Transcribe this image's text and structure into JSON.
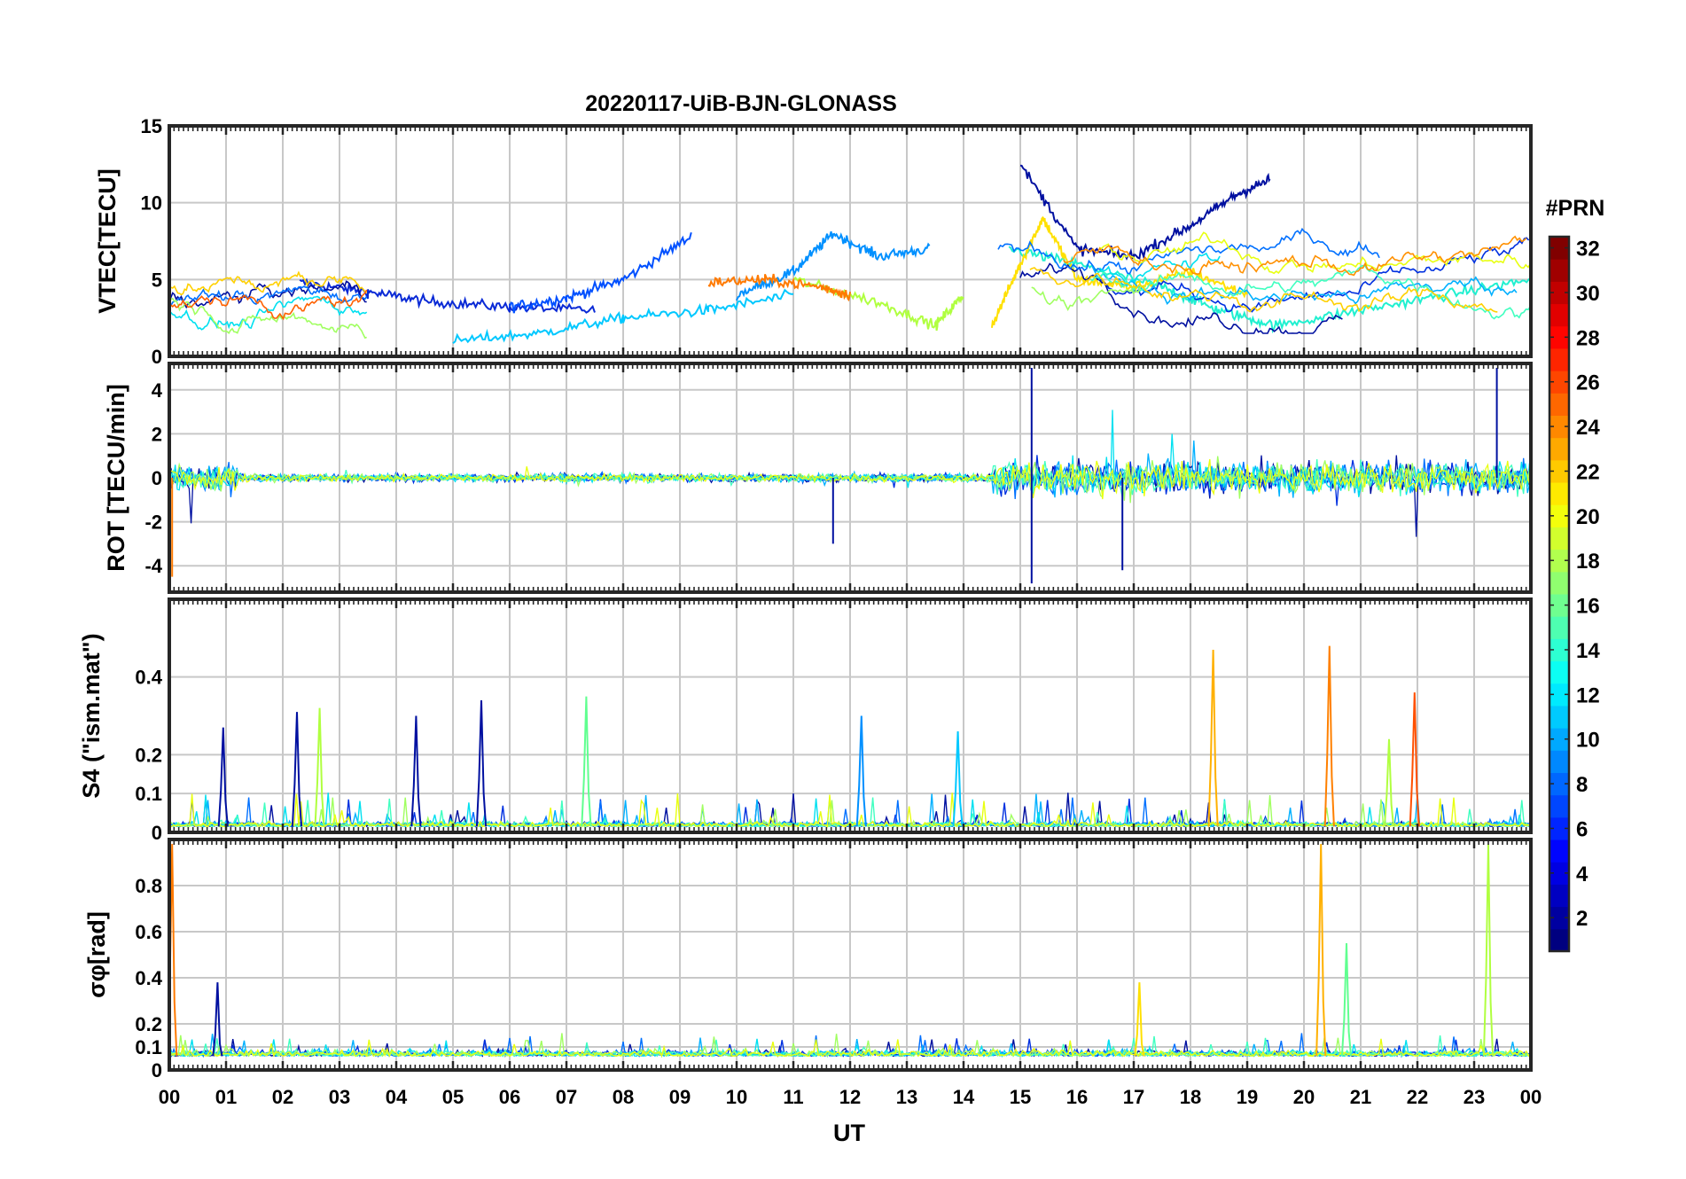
{
  "chart_data": {
    "title": "20220117-UiB-BJN-GLONASS",
    "xlabel": "UT",
    "x_tick_labels": [
      "00",
      "01",
      "02",
      "03",
      "04",
      "05",
      "06",
      "07",
      "08",
      "09",
      "10",
      "11",
      "12",
      "13",
      "14",
      "15",
      "16",
      "17",
      "18",
      "19",
      "20",
      "21",
      "22",
      "23",
      "00"
    ],
    "xlim": [
      0,
      24
    ],
    "grid": true,
    "colorbar": {
      "label": "#PRN",
      "range": [
        1,
        32
      ],
      "tick_labels": [
        "2",
        "4",
        "6",
        "8",
        "10",
        "12",
        "14",
        "16",
        "18",
        "20",
        "22",
        "24",
        "26",
        "28",
        "30",
        "32"
      ],
      "colormap": "jet"
    },
    "panels": [
      {
        "type": "line",
        "ylabel": "VTEC[TECU]",
        "ylim": [
          0,
          15
        ],
        "y_tick_labels": [
          "0",
          "5",
          "10",
          "15"
        ],
        "series": [
          {
            "prn": 3,
            "color": "#0a2ad6",
            "x": [
              2.3,
              3.5,
              4.5,
              6.0,
              7.5
            ],
            "y": [
              4.8,
              4.2,
              3.6,
              3.2,
              3.0
            ]
          },
          {
            "prn": 5,
            "color": "#0050ff",
            "x": [
              6.0,
              7.0,
              8.0,
              9.2
            ],
            "y": [
              3.2,
              3.8,
              5.0,
              7.8
            ]
          },
          {
            "prn": 7,
            "color": "#0090ff",
            "x": [
              10.0,
              11.0,
              11.7,
              12.5,
              13.4
            ],
            "y": [
              4.0,
              5.5,
              8.0,
              6.5,
              7.0
            ]
          },
          {
            "prn": 10,
            "color": "#00c8ff",
            "x": [
              5.0,
              6.5,
              8.0,
              9.5,
              11.0
            ],
            "y": [
              1.0,
              1.5,
              2.5,
              3.0,
              4.0
            ]
          },
          {
            "prn": 13,
            "color": "#20f0d0",
            "x": [
              14.8,
              16.0,
              17.5,
              18.5,
              19.5,
              21.0,
              22.5,
              24.0
            ],
            "y": [
              7.0,
              6.0,
              4.5,
              3.0,
              2.0,
              3.0,
              4.0,
              5.0
            ]
          },
          {
            "prn": 17,
            "color": "#b0ff40",
            "x": [
              11.0,
              12.5,
              13.5,
              14.0
            ],
            "y": [
              5.0,
              3.5,
              2.0,
              4.0
            ]
          },
          {
            "prn": 20,
            "color": "#ffe000",
            "x": [
              14.5,
              15.0,
              15.4,
              16.0,
              17.0,
              18.0,
              19.0
            ],
            "y": [
              2.0,
              6.0,
              9.0,
              5.0,
              4.5,
              5.5,
              4.0
            ]
          },
          {
            "prn": 23,
            "color": "#ff7a00",
            "x": [
              9.5,
              10.5,
              11.5,
              12.0
            ],
            "y": [
              4.8,
              5.0,
              4.5,
              4.0
            ]
          },
          {
            "prn": 2,
            "color": "#0010a0",
            "x": [
              15.0,
              16.0,
              17.0,
              18.0,
              18.8,
              19.4
            ],
            "y": [
              12.5,
              7.0,
              6.5,
              8.5,
              10.5,
              11.5
            ]
          }
        ]
      },
      {
        "type": "line",
        "ylabel": "ROT [TECU/min]",
        "ylim": [
          -5.2,
          5.2
        ],
        "y_tick_labels": [
          "-4",
          "-2",
          "0",
          "2",
          "4"
        ],
        "description_of_data": "Rate of TEC noise centered at 0; amplitude about ±0.3 before 14.5 UT, about ±2 after 14.5 UT with spikes to ±5 near 15.2 UT."
      },
      {
        "type": "line",
        "ylabel": "S4 (\"ism.mat\")",
        "ylim": [
          0,
          0.6
        ],
        "y_tick_labels": [
          "0",
          "0.1",
          "0.2",
          "0.4"
        ],
        "peaks": [
          {
            "x": 0.95,
            "y": 0.27,
            "color": "#0010a0"
          },
          {
            "x": 2.25,
            "y": 0.31,
            "color": "#0010a0"
          },
          {
            "x": 2.65,
            "y": 0.32,
            "color": "#b0ff40"
          },
          {
            "x": 4.35,
            "y": 0.3,
            "color": "#0010a0"
          },
          {
            "x": 5.5,
            "y": 0.34,
            "color": "#0010a0"
          },
          {
            "x": 7.35,
            "y": 0.35,
            "color": "#60ff90"
          },
          {
            "x": 12.2,
            "y": 0.3,
            "color": "#0090ff"
          },
          {
            "x": 13.9,
            "y": 0.26,
            "color": "#00c8ff"
          },
          {
            "x": 18.4,
            "y": 0.47,
            "color": "#ffb000"
          },
          {
            "x": 20.45,
            "y": 0.48,
            "color": "#ff8000"
          },
          {
            "x": 21.95,
            "y": 0.36,
            "color": "#ff5000"
          },
          {
            "x": 21.5,
            "y": 0.24,
            "color": "#b0ff40"
          }
        ]
      },
      {
        "type": "line",
        "ylabel": "σφ[rad]",
        "ylim": [
          0,
          1.0
        ],
        "y_tick_labels": [
          "0",
          "0.1",
          "0.2",
          "0.4",
          "0.6",
          "0.8"
        ],
        "peaks": [
          {
            "x": 0.05,
            "y": 0.98,
            "color": "#ff7a00"
          },
          {
            "x": 0.85,
            "y": 0.38,
            "color": "#0010a0"
          },
          {
            "x": 17.1,
            "y": 0.38,
            "color": "#ffe000"
          },
          {
            "x": 20.3,
            "y": 0.98,
            "color": "#ffb000"
          },
          {
            "x": 20.75,
            "y": 0.55,
            "color": "#60ff90"
          },
          {
            "x": 23.25,
            "y": 0.98,
            "color": "#b0ff40"
          }
        ]
      }
    ]
  }
}
